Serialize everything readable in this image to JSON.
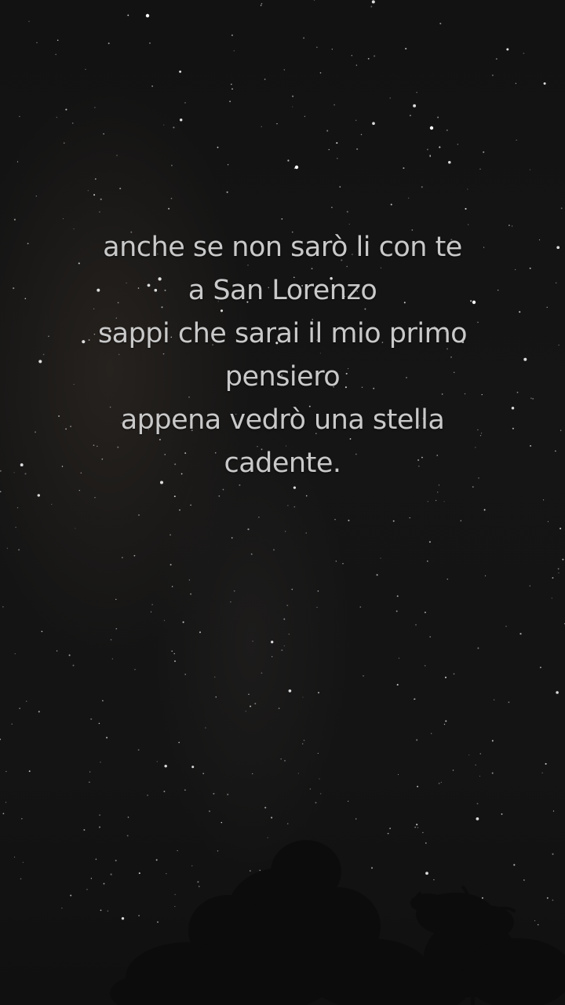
{
  "overlay_text": {
    "lines": [
      "anche se non sarò li con te",
      "a San Lorenzo",
      "sappi che sarai il mio primo",
      "pensiero",
      "appena vedrò una stella",
      "cadente."
    ]
  },
  "colors": {
    "sky": "#131313",
    "text": "#c9c9c9",
    "tree_silhouette": "#0c0c0c"
  }
}
